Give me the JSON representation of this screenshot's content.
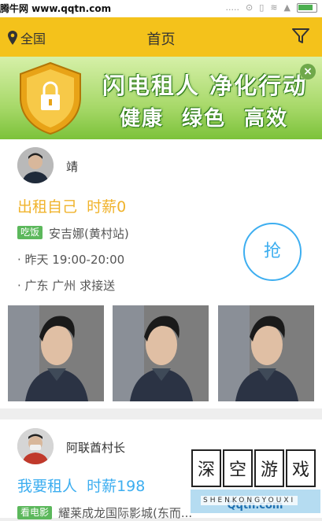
{
  "status_bar": {
    "site_watermark": "腾牛网 www.qqtn.com",
    "signal_text": "....."
  },
  "header": {
    "location": "全国",
    "title": "首页"
  },
  "banner": {
    "line1": "闪电租人 净化行动",
    "line2": "健康 绿色 高效",
    "close_symbol": "×"
  },
  "listings": [
    {
      "user_name": "靖",
      "offer": "出租自己  时薪0",
      "tag": "吃饭",
      "place": "安吉娜(黄村站)",
      "time": "·  昨天 19:00-20:00",
      "location": "·  广东 广州 求接送",
      "grab_label": "抢"
    },
    {
      "user_name": "阿联酋村长",
      "offer": "我要租人  时薪198",
      "tag": "看电影",
      "place": "耀莱成龙国际影城(东而...",
      "time": "",
      "location": ""
    }
  ],
  "watermark": {
    "chars": "深 空 游 戏",
    "pinyin": "SHENKONGYOUXI",
    "site": "Qqtn.com"
  },
  "colors": {
    "accent_yellow": "#f4c21b",
    "accent_blue": "#3daef0",
    "tag_green": "#5cb85c"
  }
}
